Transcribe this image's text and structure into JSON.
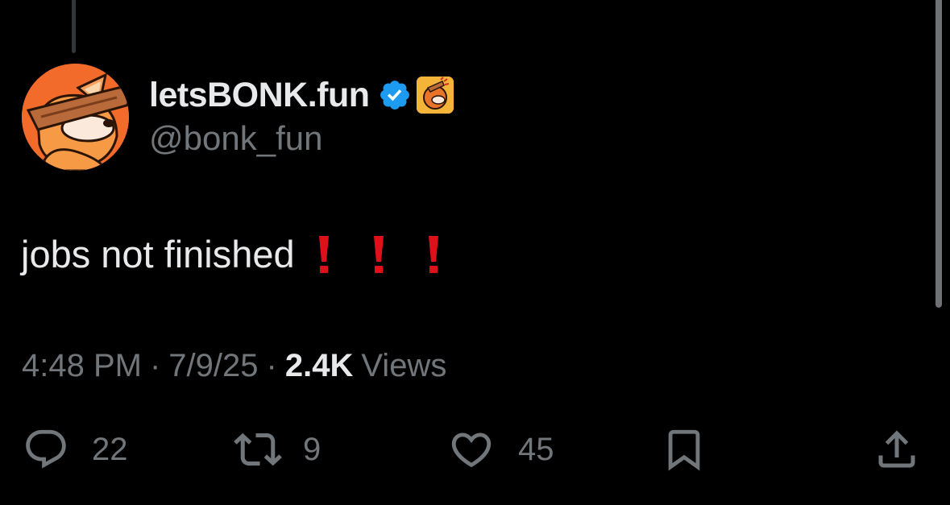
{
  "author": {
    "display_name": "letsBONK.fun",
    "handle": "@bonk_fun",
    "verified": true,
    "badge_color": "#1d9bf0",
    "affiliate_badge": "bonk-fun-logo",
    "avatar": "bonk-dog-avatar"
  },
  "tweet": {
    "text": "jobs not finished",
    "emoji": [
      "exclamation-mark-icon",
      "exclamation-mark-icon",
      "exclamation-mark-icon"
    ],
    "emoji_color": "#e0101a"
  },
  "meta": {
    "time": "4:48 PM",
    "separator": "·",
    "date": "7/9/25",
    "views_count": "2.4K",
    "views_label": "Views"
  },
  "actions": {
    "replies": "22",
    "reposts": "9",
    "likes": "45"
  },
  "colors": {
    "background": "#000000",
    "text_primary": "#e7e9ea",
    "text_secondary": "#71767b"
  }
}
